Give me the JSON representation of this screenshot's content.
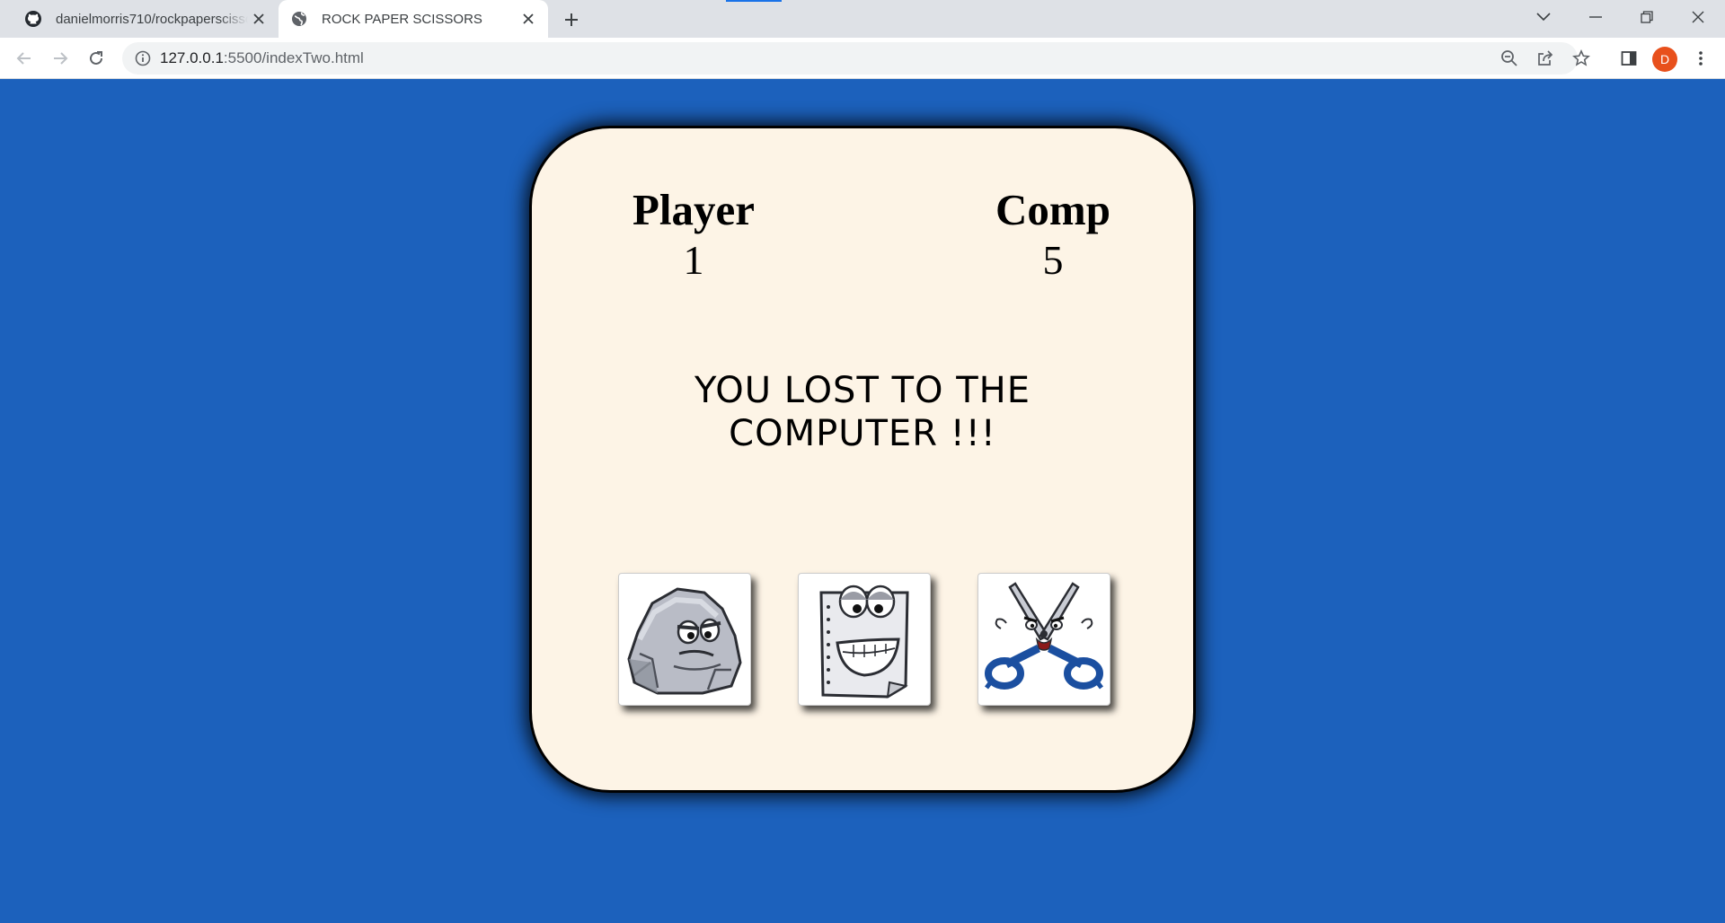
{
  "browser": {
    "tabs": [
      {
        "title": "danielmorris710/rockpaperscissors",
        "icon": "github-icon",
        "active": false
      },
      {
        "title": "ROCK PAPER SCISSORS",
        "icon": "globe-icon",
        "active": true
      }
    ],
    "url_host": "127.0.0.1",
    "url_rest": ":5500/indexTwo.html",
    "profile_initial": "D",
    "profile_color": "#e8501c"
  },
  "page": {
    "background": "#1c61bc",
    "card_background": "#fdf4e6",
    "player_label": "Player",
    "player_score": "1",
    "comp_label": "Comp",
    "comp_score": "5",
    "result_message": "YOU LOST TO THE COMPUTER !!!",
    "choices": [
      {
        "name": "rock",
        "icon": "rock-icon"
      },
      {
        "name": "paper",
        "icon": "paper-icon"
      },
      {
        "name": "scissors",
        "icon": "scissors-icon"
      }
    ]
  }
}
